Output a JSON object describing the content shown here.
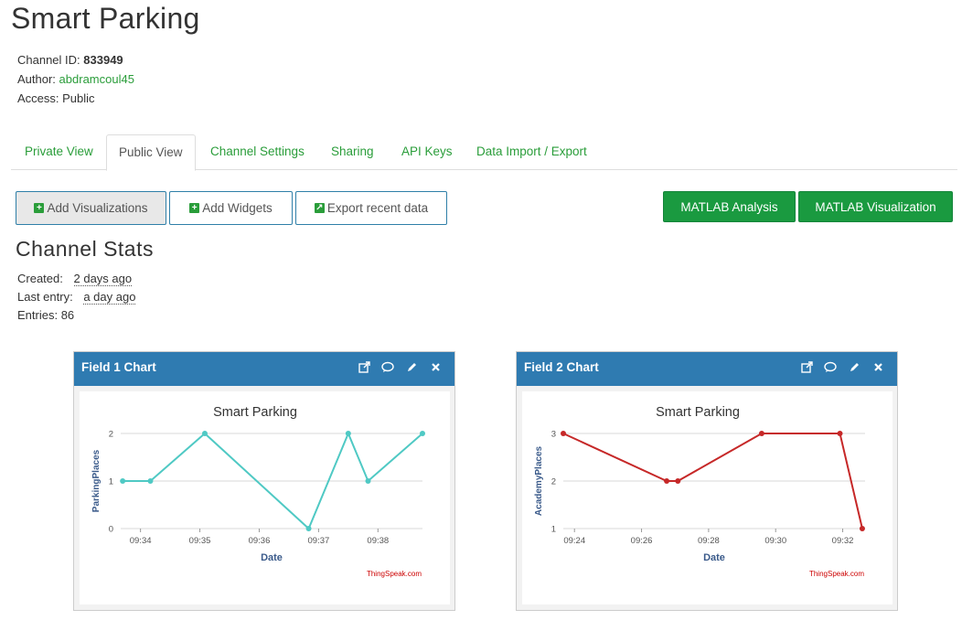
{
  "page": {
    "title": "Smart Parking"
  },
  "channel": {
    "id_label": "Channel ID:",
    "id_value": "833949",
    "author_label": "Author:",
    "author_value": "abdramcoul45",
    "access_label": "Access:",
    "access_value": "Public"
  },
  "tabs": [
    {
      "label": "Private View"
    },
    {
      "label": "Public View"
    },
    {
      "label": "Channel Settings"
    },
    {
      "label": "Sharing"
    },
    {
      "label": "API Keys"
    },
    {
      "label": "Data Import / Export"
    }
  ],
  "toolbar": {
    "add_visualizations": "Add Visualizations",
    "add_widgets": "Add Widgets",
    "export_recent": "Export recent data",
    "matlab_analysis": "MATLAB Analysis",
    "matlab_visualization": "MATLAB Visualization"
  },
  "stats": {
    "title": "Channel Stats",
    "created_label": "Created:",
    "created_value": "2 days ago",
    "last_entry_label": "Last entry:",
    "last_entry_value": "a day ago",
    "entries_label": "Entries:",
    "entries_value": "86"
  },
  "colors": {
    "accent": "#2a9d3a",
    "panel_header": "#2f7bb1",
    "series1": "#4fc9c4",
    "series2": "#c62828"
  },
  "panels": [
    {
      "title": "Field 1 Chart",
      "credit": "ThingSpeak.com"
    },
    {
      "title": "Field 2 Chart",
      "credit": "ThingSpeak.com"
    }
  ],
  "chart_data": [
    {
      "type": "line",
      "title": "Smart Parking",
      "xlabel": "Date",
      "ylabel": "ParkingPlaces",
      "x_ticks": [
        "09:34",
        "09:35",
        "09:36",
        "09:37",
        "09:38"
      ],
      "y_ticks": [
        0,
        1,
        2
      ],
      "ylim": [
        0,
        2
      ],
      "xlim": [
        "09:33:40",
        "09:38:45"
      ],
      "grid": true,
      "series": [
        {
          "color": "#4fc9c4",
          "x": [
            "09:33:42",
            "09:34:10",
            "09:35:05",
            "09:36:50",
            "09:37:30",
            "09:37:50",
            "09:38:45"
          ],
          "y": [
            1,
            1,
            2,
            0,
            2,
            1,
            2
          ]
        }
      ]
    },
    {
      "type": "line",
      "title": "Smart Parking",
      "xlabel": "Date",
      "ylabel": "AcademyPlaces",
      "x_ticks": [
        "09:24",
        "09:26",
        "09:28",
        "09:30",
        "09:32"
      ],
      "y_ticks": [
        1,
        2,
        3
      ],
      "ylim": [
        1,
        3
      ],
      "xlim": [
        "09:23:40",
        "09:32:40"
      ],
      "grid": true,
      "series": [
        {
          "color": "#c62828",
          "x": [
            "09:23:40",
            "09:26:45",
            "09:27:05",
            "09:29:35",
            "09:31:55",
            "09:32:35"
          ],
          "y": [
            3,
            2,
            2,
            3,
            3,
            1
          ]
        }
      ]
    }
  ]
}
